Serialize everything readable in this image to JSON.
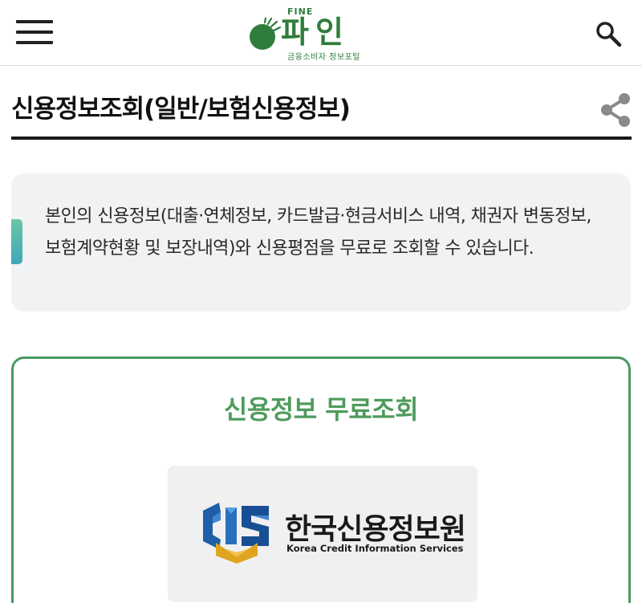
{
  "header": {
    "logo": {
      "brand_small": "FINE",
      "brand_name": "파인",
      "tagline": "금융소비자 정보포털"
    },
    "menu_icon": "hamburger-menu-icon",
    "search_icon": "search-icon"
  },
  "page": {
    "title": "신용정보조회(일반/보험신용정보)",
    "share_icon": "share-icon"
  },
  "info": {
    "text": "본인의 신용정보(대출·연체정보, 카드발급·현금서비스 내역, 채권자 변동정보, 보험계약현황 및 보장내역)와 신용평점을 무료로 조회할 수 있습니다."
  },
  "card": {
    "title": "신용정보 무료조회",
    "agency": {
      "name_ko": "한국신용정보원",
      "name_en": "Korea Credit Information Services"
    }
  },
  "colors": {
    "brand_green": "#2f7d3b",
    "card_title_green": "#4e9b5c",
    "card_border": "#4a9a60",
    "info_bg": "#f1f2f4",
    "accent_teal": "#3ea7b9",
    "kcis_blue": "#1f5fa8",
    "kcis_gold": "#e0a520"
  }
}
